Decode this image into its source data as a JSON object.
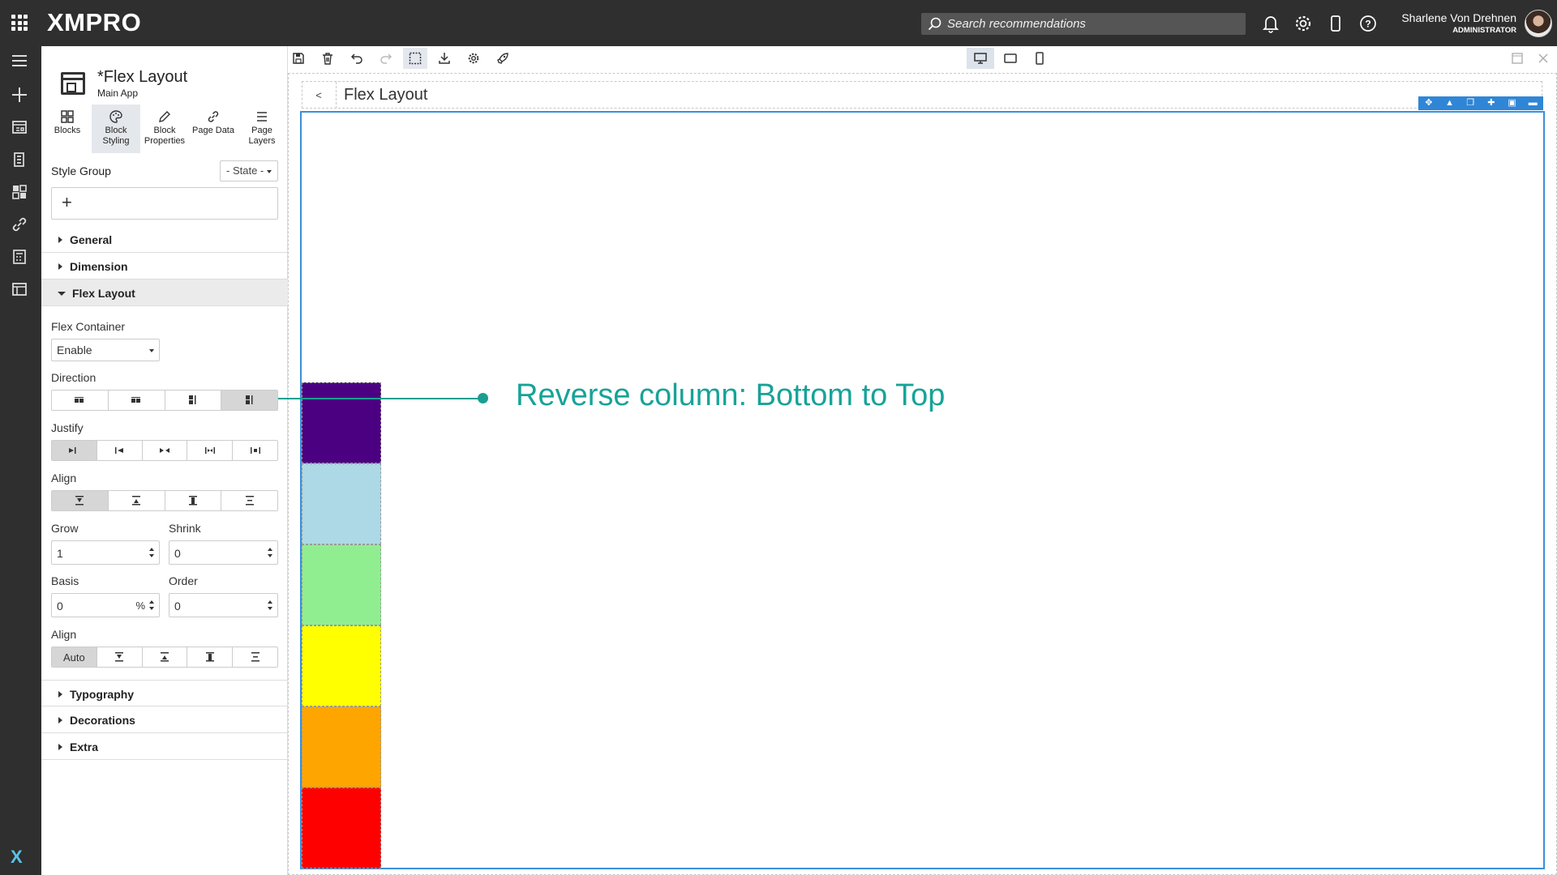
{
  "app": {
    "logo": "XMPRO"
  },
  "search": {
    "placeholder": "Search recommendations"
  },
  "user": {
    "name": "Sharlene Von Drehnen",
    "role": "ADMINISTRATOR"
  },
  "page": {
    "title": "*Flex Layout",
    "app_name": "Main App"
  },
  "panel_tabs": [
    {
      "label_1": "Blocks",
      "label_2": "",
      "icon": "blocks-icon"
    },
    {
      "label_1": "Block",
      "label_2": "Styling",
      "icon": "palette-icon"
    },
    {
      "label_1": "Block",
      "label_2": "Properties",
      "icon": "pencil-icon"
    },
    {
      "label_1": "Page Data",
      "label_2": "",
      "icon": "link-icon"
    },
    {
      "label_1": "Page",
      "label_2": "Layers",
      "icon": "layers-icon"
    }
  ],
  "style_group": {
    "label": "Style Group",
    "state": "- State -",
    "add": "+"
  },
  "sections": {
    "general": "General",
    "dimension": "Dimension",
    "flex_layout": "Flex Layout",
    "typography": "Typography",
    "decorations": "Decorations",
    "extra": "Extra"
  },
  "flex": {
    "container_label": "Flex Container",
    "container_value": "Enable",
    "direction_label": "Direction",
    "direction_selected": "reverse-column",
    "justify_label": "Justify",
    "align_label": "Align",
    "grow_label": "Grow",
    "grow_value": "1",
    "shrink_label": "Shrink",
    "shrink_value": "0",
    "basis_label": "Basis",
    "basis_value": "0",
    "basis_unit": "%",
    "order_label": "Order",
    "order_value": "0",
    "align_self_label": "Align",
    "align_self_auto": "Auto"
  },
  "canvas": {
    "back": "<",
    "title": "Flex Layout",
    "blocks_bottom_to_top": [
      "red",
      "orange",
      "yellow",
      "light-green",
      "light-blue",
      "indigo"
    ],
    "block_colors": {
      "red": "#ff0000",
      "orange": "#ffa500",
      "yellow": "#ffff00",
      "light-green": "#90ee90",
      "light-blue": "#add8e6",
      "indigo": "#4b0082"
    }
  },
  "annotation": {
    "text": "Reverse column: Bottom to Top",
    "color": "#17a398"
  },
  "colors": {
    "topbar": "#2f2f2f",
    "selection": "#3b8fd9",
    "block_toolbar": "#2f86d6"
  }
}
